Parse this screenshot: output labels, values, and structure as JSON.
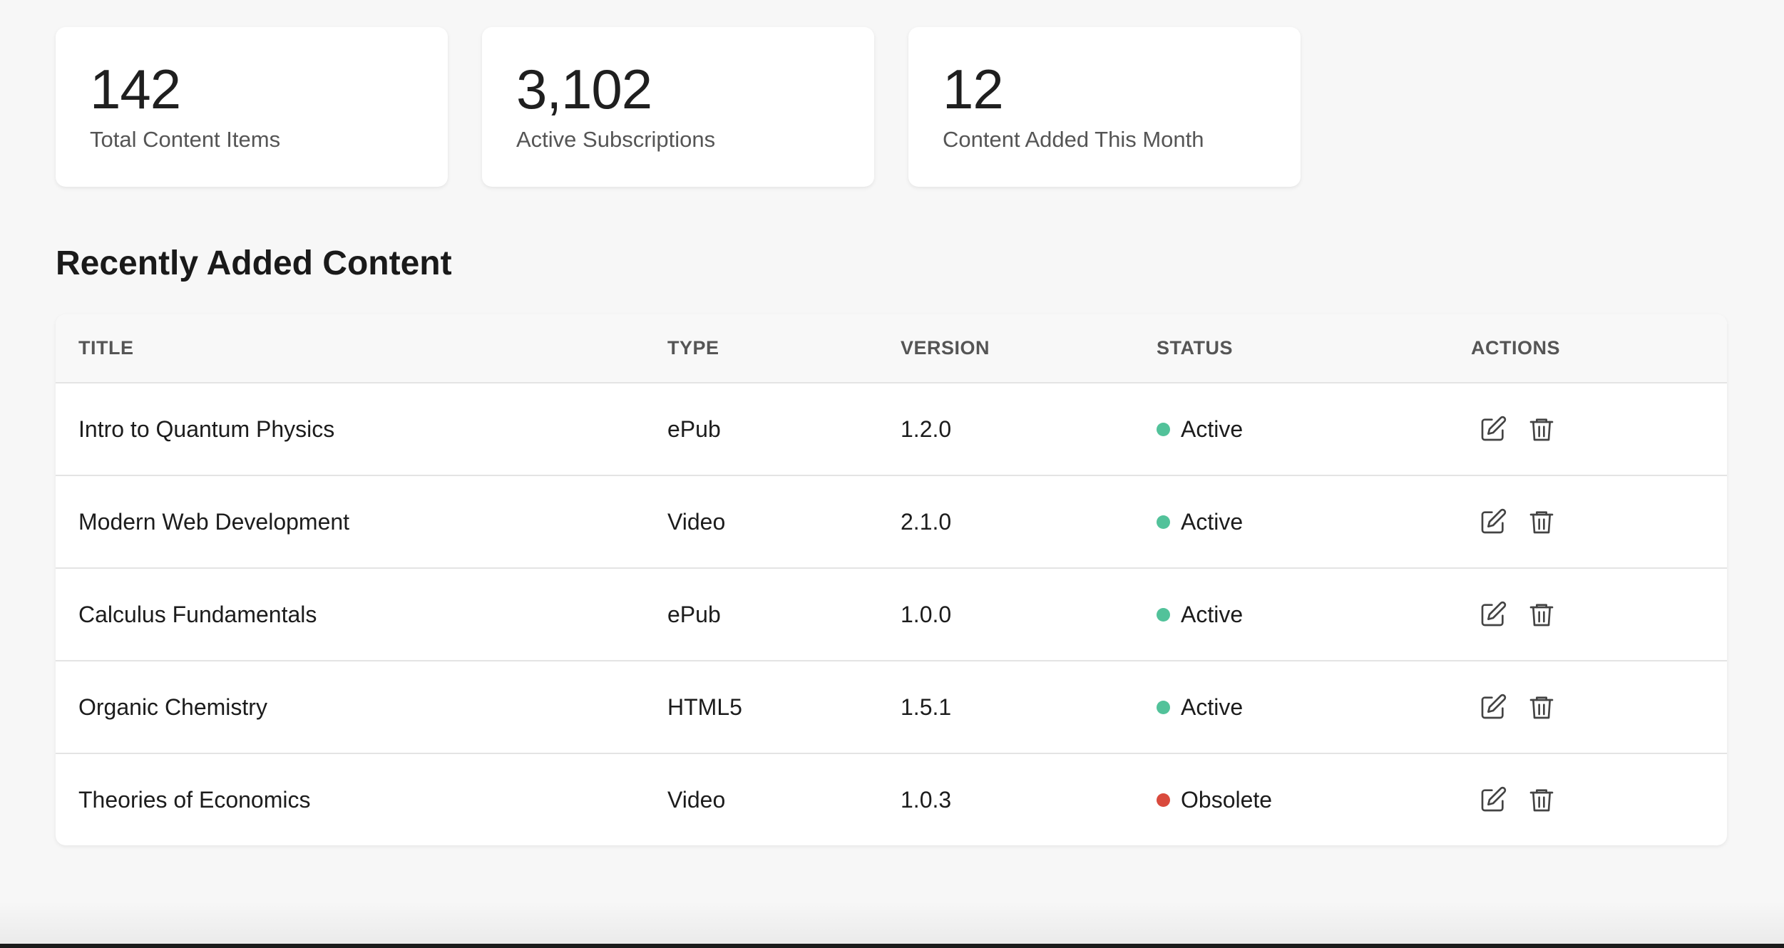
{
  "stats": [
    {
      "value": "142",
      "label": "Total Content Items"
    },
    {
      "value": "3,102",
      "label": "Active Subscriptions"
    },
    {
      "value": "12",
      "label": "Content Added This Month"
    }
  ],
  "section_title": "Recently Added Content",
  "table": {
    "headers": [
      "TITLE",
      "TYPE",
      "VERSION",
      "STATUS",
      "ACTIONS"
    ],
    "rows": [
      {
        "title": "Intro to Quantum Physics",
        "type": "ePub",
        "version": "1.2.0",
        "status": "Active"
      },
      {
        "title": "Modern Web Development",
        "type": "Video",
        "version": "2.1.0",
        "status": "Active"
      },
      {
        "title": "Calculus Fundamentals",
        "type": "ePub",
        "version": "1.0.0",
        "status": "Active"
      },
      {
        "title": "Organic Chemistry",
        "type": "HTML5",
        "version": "1.5.1",
        "status": "Active"
      },
      {
        "title": "Theories of Economics",
        "type": "Video",
        "version": "1.0.3",
        "status": "Obsolete"
      }
    ]
  },
  "icons": {
    "edit": "edit-icon",
    "delete": "trash-icon"
  },
  "colors": {
    "status_active": "#52c29a",
    "status_obsolete": "#d94a3d",
    "icon": "#444444"
  }
}
